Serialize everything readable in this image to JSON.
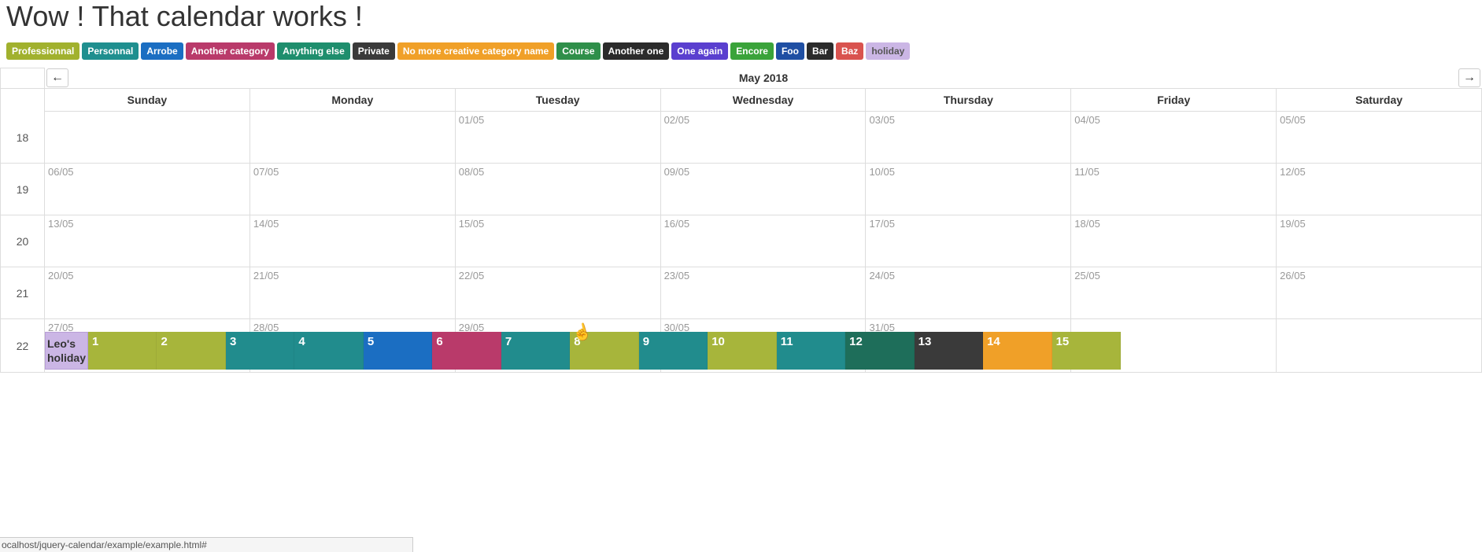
{
  "title": "Wow ! That calendar works !",
  "categories": [
    {
      "label": "Professionnal",
      "color": "#a1b12e"
    },
    {
      "label": "Personnal",
      "color": "#1f8f8f"
    },
    {
      "label": "Arrobe",
      "color": "#1b6ec2"
    },
    {
      "label": "Another category",
      "color": "#b93a6a"
    },
    {
      "label": "Anything else",
      "color": "#1e8e6d"
    },
    {
      "label": "Private",
      "color": "#3a3a3a"
    },
    {
      "label": "No more creative category name",
      "color": "#f0a028"
    },
    {
      "label": "Course",
      "color": "#2f8f4a"
    },
    {
      "label": "Another one",
      "color": "#2b2b2b"
    },
    {
      "label": "One again",
      "color": "#5a3fcf"
    },
    {
      "label": "Encore",
      "color": "#3aa33a"
    },
    {
      "label": "Foo",
      "color": "#1f4fa3"
    },
    {
      "label": "Bar",
      "color": "#2b2b2b"
    },
    {
      "label": "Baz",
      "color": "#d9534f"
    },
    {
      "label": "holiday",
      "color": "#cbb6e5",
      "text": "#555"
    }
  ],
  "calendar": {
    "month_label": "May 2018",
    "prev_label": "←",
    "next_label": "→",
    "day_headers": [
      "Sunday",
      "Monday",
      "Tuesday",
      "Wednesday",
      "Thursday",
      "Friday",
      "Saturday"
    ],
    "weeks": [
      {
        "num": "18",
        "days": [
          "",
          "",
          "01/05",
          "02/05",
          "03/05",
          "04/05",
          "05/05"
        ]
      },
      {
        "num": "19",
        "days": [
          "06/05",
          "07/05",
          "08/05",
          "09/05",
          "10/05",
          "11/05",
          "12/05"
        ]
      },
      {
        "num": "20",
        "days": [
          "13/05",
          "14/05",
          "15/05",
          "16/05",
          "17/05",
          "18/05",
          "19/05"
        ]
      },
      {
        "num": "21",
        "days": [
          "20/05",
          "21/05",
          "22/05",
          "23/05",
          "24/05",
          "25/05",
          "26/05"
        ]
      },
      {
        "num": "22",
        "days": [
          "27/05",
          "28/05",
          "29/05",
          "30/05",
          "31/05",
          "",
          ""
        ]
      }
    ],
    "event_row_week": 4,
    "holiday_event_label": "Leo's holiday",
    "event_blocks": [
      {
        "num": "1",
        "color": "#a7b53b"
      },
      {
        "num": "2",
        "color": "#a7b53b"
      },
      {
        "num": "3",
        "color": "#218c8d"
      },
      {
        "num": "4",
        "color": "#218c8d"
      },
      {
        "num": "5",
        "color": "#1b6ec2"
      },
      {
        "num": "6",
        "color": "#b93a6a"
      },
      {
        "num": "7",
        "color": "#218c8d"
      },
      {
        "num": "8",
        "color": "#a7b53b"
      },
      {
        "num": "9",
        "color": "#218c8d"
      },
      {
        "num": "10",
        "color": "#a7b53b"
      },
      {
        "num": "11",
        "color": "#218c8d"
      },
      {
        "num": "12",
        "color": "#1e6e5a"
      },
      {
        "num": "13",
        "color": "#3a3a3a"
      },
      {
        "num": "14",
        "color": "#f0a028"
      },
      {
        "num": "15",
        "color": "#a7b53b"
      }
    ]
  },
  "status_bar": "ocalhost/jquery-calendar/example/example.html#"
}
